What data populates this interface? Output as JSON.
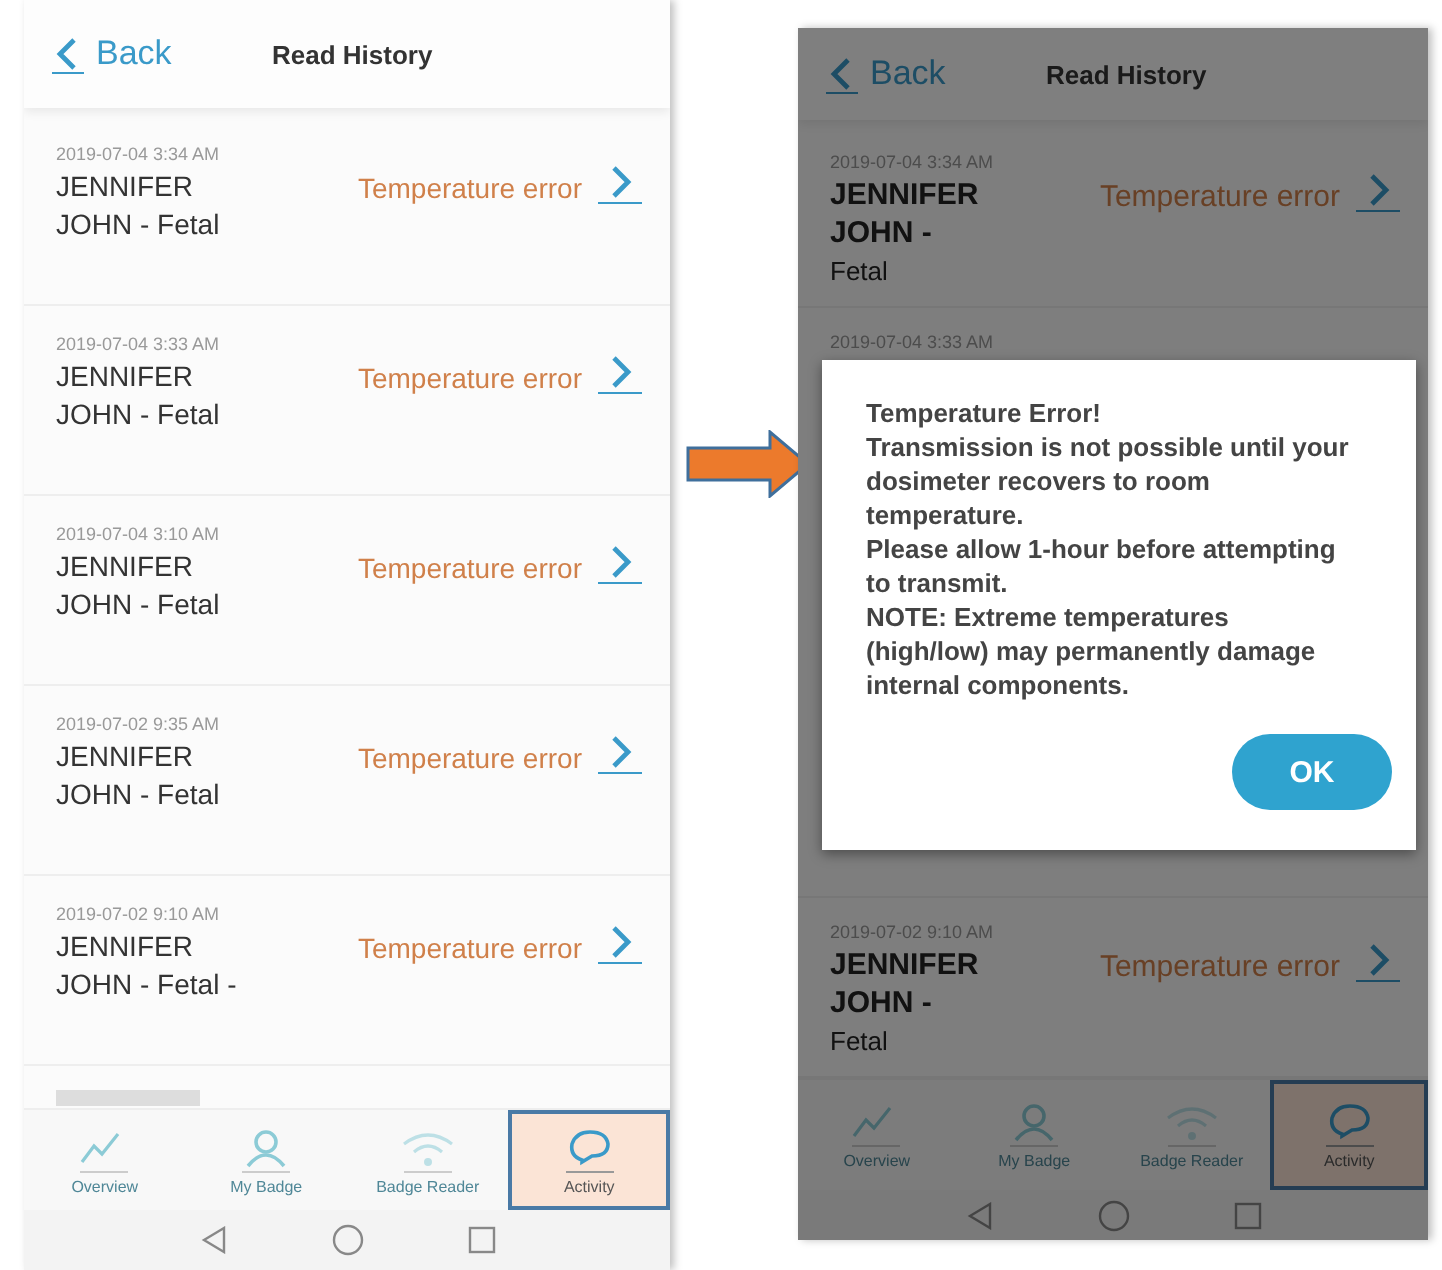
{
  "screens": [
    {
      "dimmed": false,
      "loading_placeholder": true,
      "header": {
        "back": "Back",
        "title": "Read History"
      },
      "reads": [
        {
          "time": "2019-07-04 3:34 AM",
          "name_lines": [
            "JENNIFER",
            "JOHN - Fetal"
          ],
          "status": "Temperature error"
        },
        {
          "time": "2019-07-04 3:33 AM",
          "name_lines": [
            "JENNIFER",
            "JOHN - Fetal"
          ],
          "status": "Temperature error"
        },
        {
          "time": "2019-07-04 3:10 AM",
          "name_lines": [
            "JENNIFER",
            "JOHN - Fetal"
          ],
          "status": "Temperature error"
        },
        {
          "time": "2019-07-02 9:35 AM",
          "name_lines": [
            "JENNIFER",
            "JOHN - Fetal"
          ],
          "status": "Temperature error"
        },
        {
          "time": "2019-07-02 9:10 AM",
          "name_lines": [
            "JENNIFER",
            "JOHN - Fetal  -"
          ],
          "status": "Temperature error"
        }
      ],
      "tabs": [
        {
          "kind": "chart",
          "label": "Overview",
          "selected": false
        },
        {
          "kind": "person",
          "label": "My Badge",
          "selected": false
        },
        {
          "kind": "wifi",
          "label": "Badge Reader",
          "selected": false
        },
        {
          "kind": "bubble",
          "label": "Activity",
          "selected": true
        }
      ]
    },
    {
      "dimmed": true,
      "loading_placeholder": false,
      "header": {
        "back": "Back",
        "title": "Read History"
      },
      "reads": [
        {
          "time": "2019-07-04 3:34 AM",
          "name_lines": [
            "JENNIFER",
            "JOHN -",
            "Fetal"
          ],
          "status": "Temperature error"
        },
        {
          "time": "2019-07-04 3:33 AM"
        },
        {
          "time": "2019-07-02 9:10 AM",
          "name_lines": [
            "JENNIFER",
            "JOHN -",
            "Fetal"
          ],
          "status": "Temperature error"
        }
      ],
      "dialog": {
        "lines": [
          "Temperature Error!",
          "Transmission is not possible until your dosimeter recovers to room temperature.",
          "Please allow 1-hour before attempting to transmit.",
          "NOTE: Extreme temperatures (high/low) may permanently damage internal components."
        ],
        "button": "OK"
      },
      "tabs": [
        {
          "kind": "chart",
          "label": "Overview",
          "selected": false
        },
        {
          "kind": "person",
          "label": "My Badge",
          "selected": false
        },
        {
          "kind": "wifi",
          "label": "Badge Reader",
          "selected": false
        },
        {
          "kind": "bubble",
          "label": "Activity",
          "selected": true
        }
      ]
    }
  ]
}
